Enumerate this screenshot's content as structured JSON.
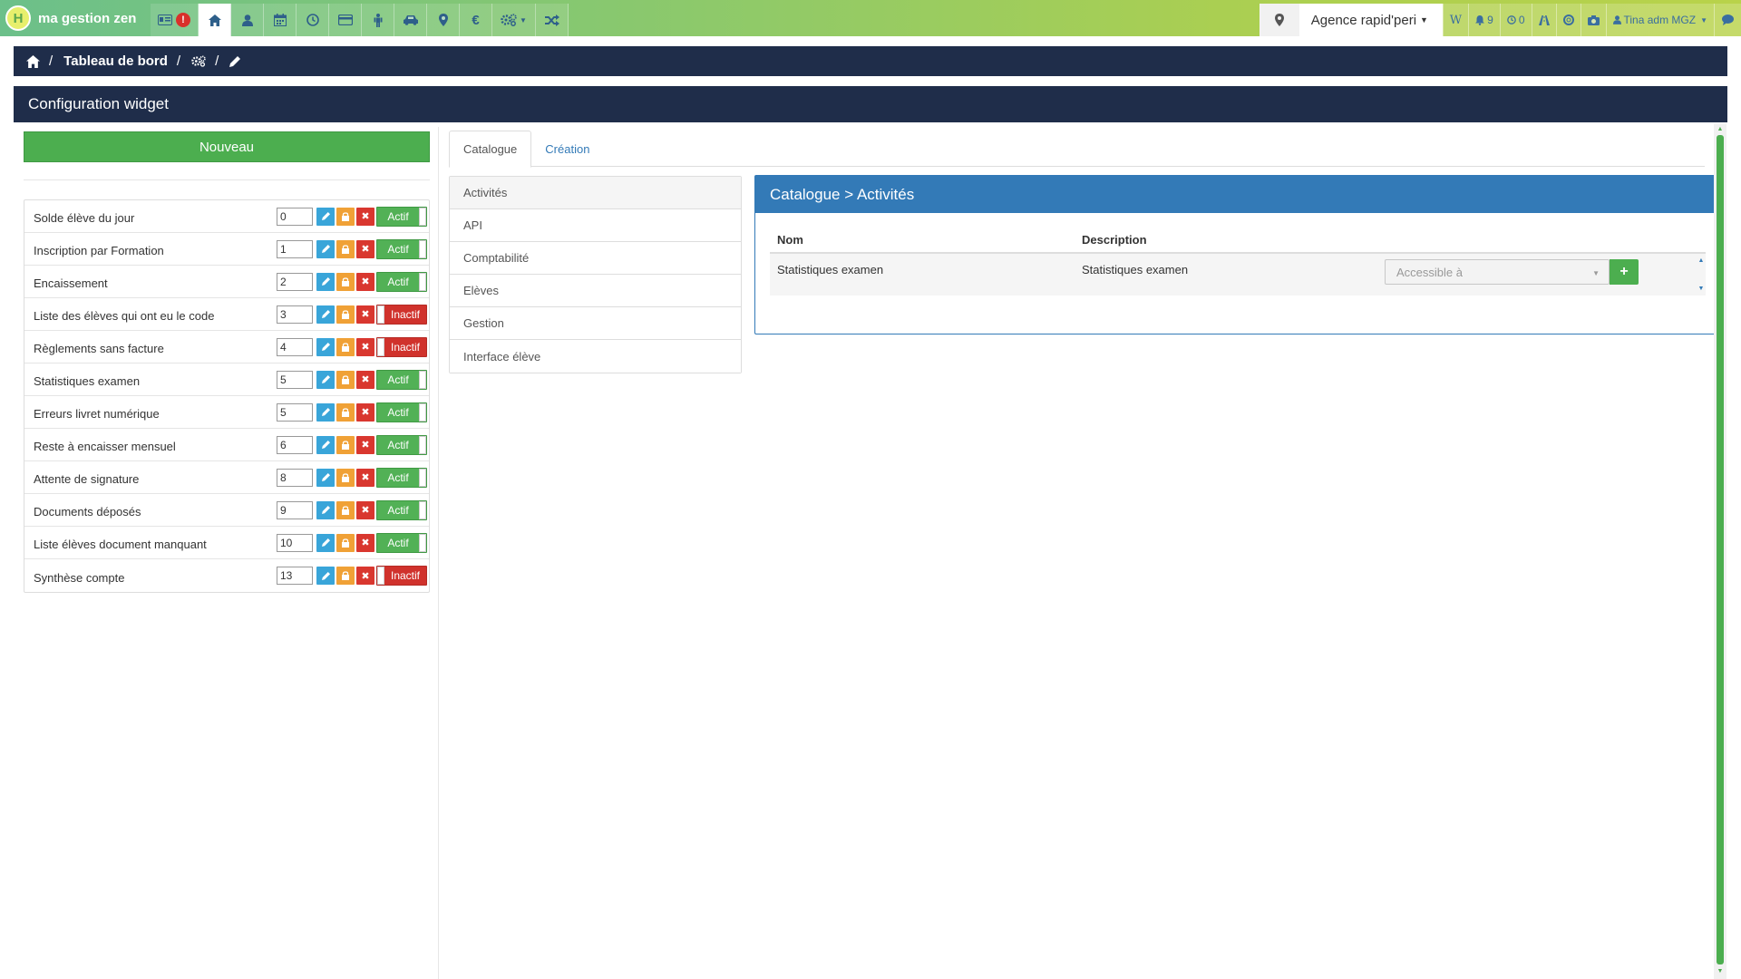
{
  "app": {
    "logo_letter": "H",
    "name": "ma gestion zen"
  },
  "topnav": {
    "items": [
      {
        "icon": "id-card-icon",
        "alert": "!"
      },
      {
        "icon": "home-icon"
      },
      {
        "icon": "user-icon"
      },
      {
        "icon": "calendar-icon"
      },
      {
        "icon": "clock-icon"
      },
      {
        "icon": "credit-card-icon"
      },
      {
        "icon": "person-icon"
      },
      {
        "icon": "car-icon"
      },
      {
        "icon": "map-marker-icon"
      },
      {
        "icon": "euro-icon",
        "glyph": "€"
      },
      {
        "icon": "cogs-icon"
      },
      {
        "icon": "shuffle-icon"
      }
    ]
  },
  "topright": {
    "agency": "Agence rapid'peri",
    "w_label": "W",
    "notifications": "9",
    "alerts": "0",
    "user": "Tina adm MGZ"
  },
  "breadcrumb": {
    "dashboard": "Tableau de bord"
  },
  "page": {
    "title": "Configuration widget"
  },
  "left": {
    "new_button": "Nouveau",
    "widgets": [
      {
        "name": "Solde élève du jour",
        "order": "0",
        "status": "Actif"
      },
      {
        "name": "Inscription par Formation",
        "order": "1",
        "status": "Actif"
      },
      {
        "name": "Encaissement",
        "order": "2",
        "status": "Actif"
      },
      {
        "name": "Liste des élèves qui ont eu le code",
        "order": "3",
        "status": "Inactif"
      },
      {
        "name": "Règlements sans facture",
        "order": "4",
        "status": "Inactif"
      },
      {
        "name": "Statistiques examen",
        "order": "5",
        "status": "Actif"
      },
      {
        "name": "Erreurs livret numérique",
        "order": "5",
        "status": "Actif"
      },
      {
        "name": "Reste à encaisser mensuel",
        "order": "6",
        "status": "Actif"
      },
      {
        "name": "Attente de signature",
        "order": "8",
        "status": "Actif"
      },
      {
        "name": "Documents déposés",
        "order": "9",
        "status": "Actif"
      },
      {
        "name": "Liste élèves document manquant",
        "order": "10",
        "status": "Actif"
      },
      {
        "name": "Synthèse compte",
        "order": "13",
        "status": "Inactif"
      }
    ]
  },
  "tabs": {
    "catalogue": "Catalogue",
    "creation": "Création"
  },
  "categories": [
    "Activités",
    "API",
    "Comptabilité",
    "Elèves",
    "Gestion",
    "Interface élève"
  ],
  "panel": {
    "title": "Catalogue > Activités",
    "col_name": "Nom",
    "col_description": "Description",
    "rows": [
      {
        "name": "Statistiques examen",
        "description": "Statistiques examen",
        "select_placeholder": "Accessible à",
        "add": "+"
      }
    ]
  },
  "colors": {
    "nav_dark": "#1f2d4a",
    "green": "#4cae4f",
    "blue": "#337ab7",
    "red": "#d0322c"
  }
}
